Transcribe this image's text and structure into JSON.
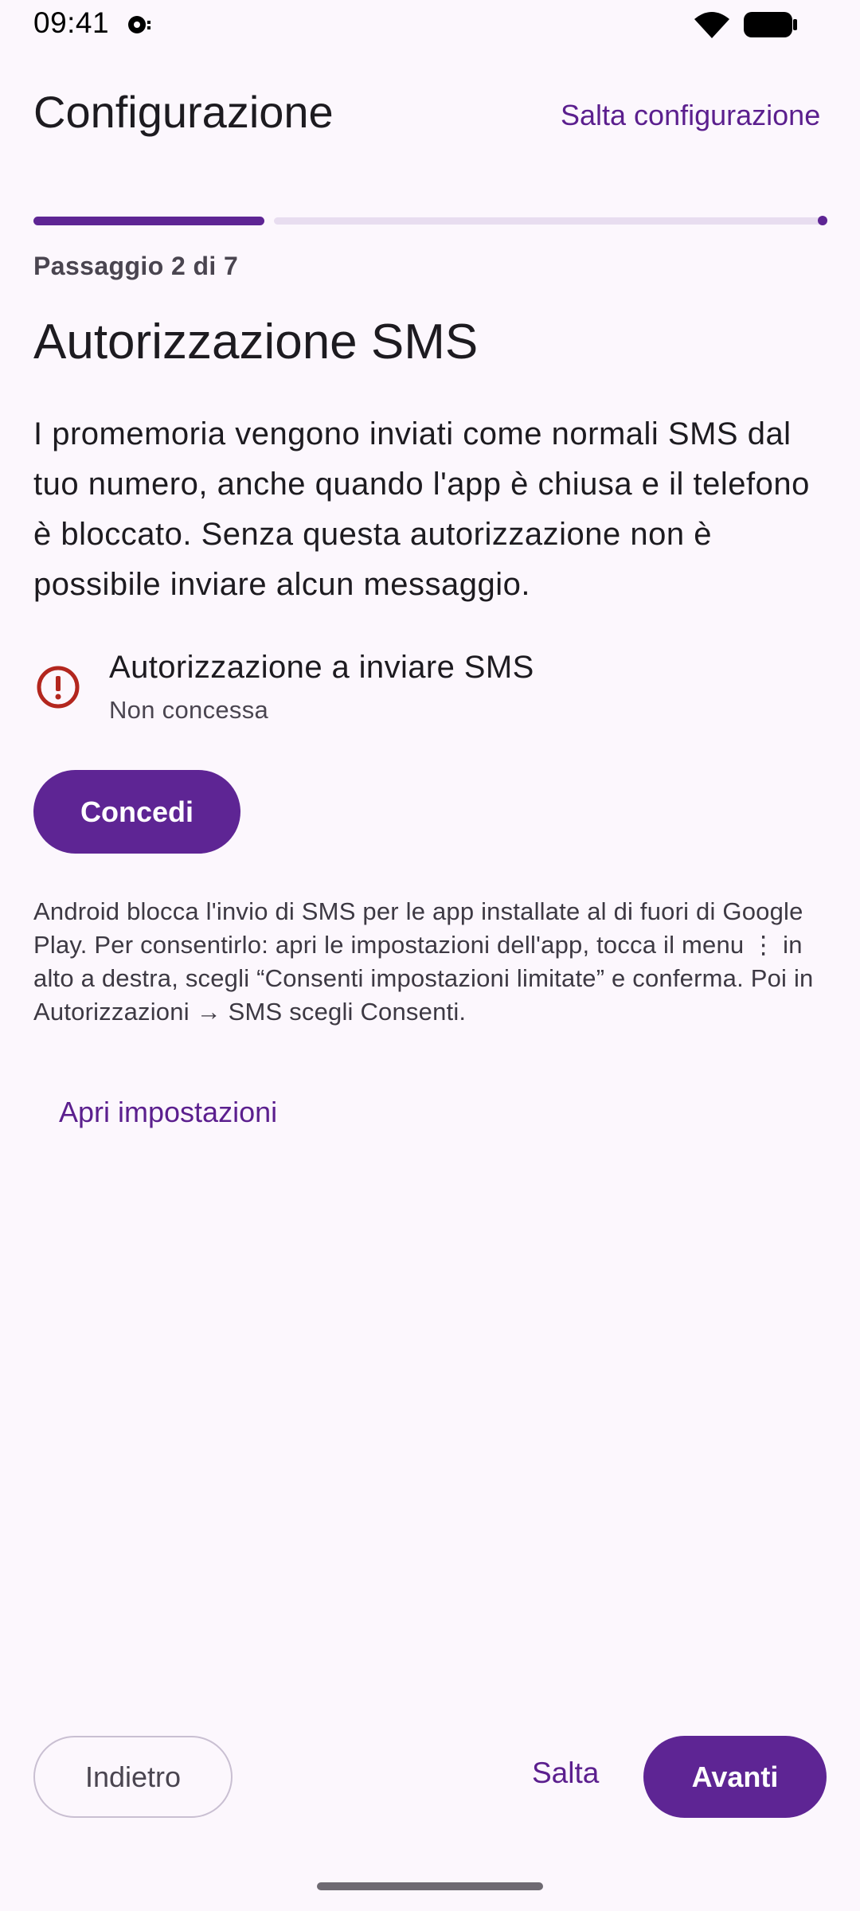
{
  "status_bar": {
    "time": "09:41",
    "icons": [
      "notification-icon",
      "wifi-icon",
      "battery-icon"
    ]
  },
  "header": {
    "title": "Configurazione",
    "skip_setup_label": "Salta configurazione"
  },
  "progress": {
    "step_label": "Passaggio 2 di 7",
    "current_step": 2,
    "total_steps": 7
  },
  "section": {
    "title": "Autorizzazione SMS",
    "description": "I promemoria vengono inviati come normali SMS dal tuo numero, anche quando l'app è chiusa e il telefono è bloccato. Senza questa autorizzazione non è possibile inviare alcun messaggio."
  },
  "permission": {
    "icon": "error-icon",
    "title": "Autorizzazione a inviare SMS",
    "status": "Non concessa",
    "grant_label": "Concedi"
  },
  "help": {
    "text": "Android blocca l'invio di SMS per le app installate al di fuori di Google Play. Per consentirlo: apri le impostazioni dell'app, tocca il menu ⋮ in alto a destra, scegli “Consenti impostazioni limitate” e conferma. Poi in Autorizzazioni → SMS scegli Consenti.",
    "open_settings_label": "Apri impostazioni"
  },
  "footer": {
    "back_label": "Indietro",
    "skip_label": "Salta",
    "next_label": "Avanti"
  },
  "colors": {
    "primary": "#5E2594",
    "background": "#FCF7FD",
    "error": "#B3261E",
    "track": "#E8DDF0"
  }
}
